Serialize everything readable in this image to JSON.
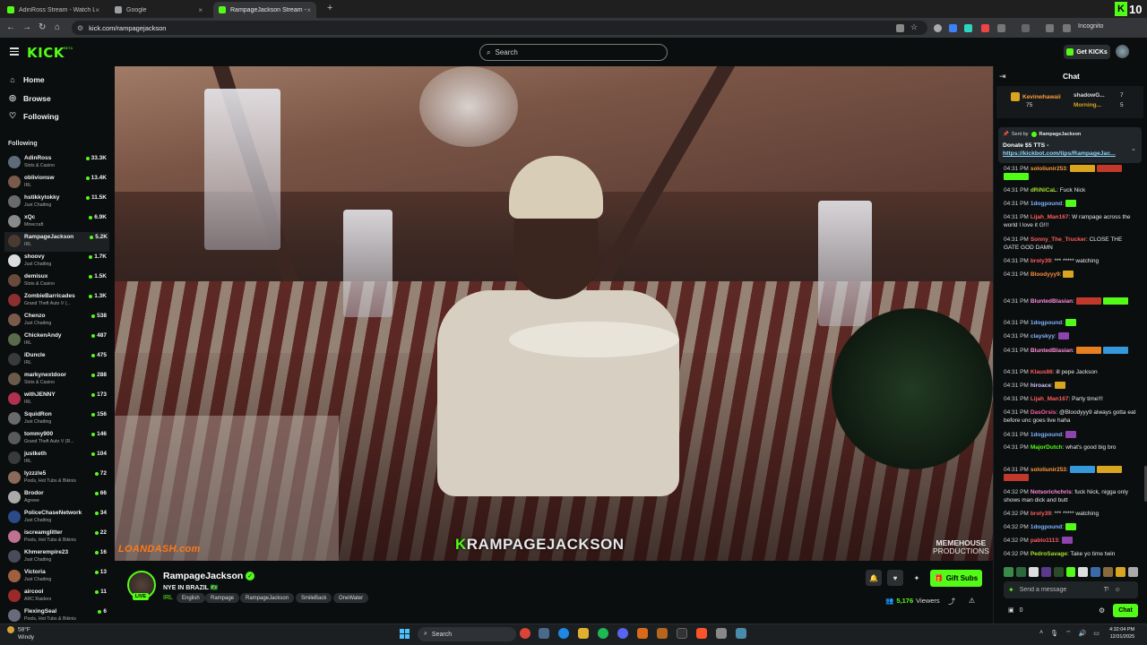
{
  "browser": {
    "tabs": [
      {
        "title": "AdinRoss Stream - Watch Live ...",
        "favicon_color": "#53fc18"
      },
      {
        "title": "Google",
        "favicon_color": "#9aa0a6"
      },
      {
        "title": "RampageJackson Stream - ...",
        "favicon_color": "#53fc18",
        "active": true
      }
    ],
    "new_tab": "+",
    "url": "kick.com/rampagejackson",
    "incognito_label": "Incognito",
    "corner_kick_count": "10",
    "corner_twitch_count": "0"
  },
  "header": {
    "logo": "KICK",
    "logo_beta": "BETA",
    "search_placeholder": "Search",
    "get_kicks": "Get KICKs"
  },
  "sidebar": {
    "nav": [
      {
        "label": "Home",
        "icon": "home-icon"
      },
      {
        "label": "Browse",
        "icon": "browse-icon"
      },
      {
        "label": "Following",
        "icon": "heart-icon"
      }
    ],
    "following_heading": "Following",
    "channels": [
      {
        "name": "AdinRoss",
        "category": "Slots & Casino",
        "viewers": "33.3K",
        "color": "#5d6b7a"
      },
      {
        "name": "oblivionsw",
        "category": "IRL",
        "viewers": "13.4K",
        "color": "#7a5a4a"
      },
      {
        "name": "hstikkytokky",
        "category": "Just Chatting",
        "viewers": "11.5K",
        "color": "#6a6a6a"
      },
      {
        "name": "xQc",
        "category": "Minecraft",
        "viewers": "6.9K",
        "color": "#8a8a8a"
      },
      {
        "name": "RampageJackson",
        "category": "IRL",
        "viewers": "5.2K",
        "color": "#4a3a30",
        "active": true
      },
      {
        "name": "shoovy",
        "category": "Just Chatting",
        "viewers": "1.7K",
        "color": "#ddd"
      },
      {
        "name": "demisux",
        "category": "Slots & Casino",
        "viewers": "1.5K",
        "color": "#6a4a3a"
      },
      {
        "name": "ZombieBarricades",
        "category": "Grand Theft Auto V (...",
        "viewers": "1.3K",
        "color": "#8a3030"
      },
      {
        "name": "Chenzo",
        "category": "Just Chatting",
        "viewers": "538",
        "color": "#7a5a4a"
      },
      {
        "name": "ChickenAndy",
        "category": "IRL",
        "viewers": "487",
        "color": "#5a6a4a"
      },
      {
        "name": "iDuncle",
        "category": "IRL",
        "viewers": "475",
        "color": "#3a3a3a"
      },
      {
        "name": "markynextdoor",
        "category": "Slots & Casino",
        "viewers": "288",
        "color": "#6a5a4a"
      },
      {
        "name": "withJENNY",
        "category": "IRL",
        "viewers": "173",
        "color": "#b03050"
      },
      {
        "name": "SquidRon",
        "category": "Just Chatting",
        "viewers": "156",
        "color": "#6a6a6a"
      },
      {
        "name": "tommy900",
        "category": "Grand Theft Auto V (R...",
        "viewers": "146",
        "color": "#5a5a5a"
      },
      {
        "name": "justketh",
        "category": "IRL",
        "viewers": "104",
        "color": "#3a3a3a"
      },
      {
        "name": "lyzzzle5",
        "category": "Pools, Hot Tubs & Bikinis",
        "viewers": "72",
        "color": "#8a6a5a"
      },
      {
        "name": "Brodor",
        "category": "Agreee",
        "viewers": "66",
        "color": "#aaa"
      },
      {
        "name": "PoliceChaseNetwork",
        "category": "Just Chatting",
        "viewers": "34",
        "color": "#2a4a8a"
      },
      {
        "name": "iscreamglitter",
        "category": "Pools, Hot Tubs & Bikinis",
        "viewers": "22",
        "color": "#c07090"
      },
      {
        "name": "Khmerempire23",
        "category": "Just Chatting",
        "viewers": "16",
        "color": "#4a4a5a"
      },
      {
        "name": "Victoria",
        "category": "Just Chatting",
        "viewers": "13",
        "color": "#a06040"
      },
      {
        "name": "aircool",
        "category": "ARC Raiders",
        "viewers": "11",
        "color": "#9a2a2a"
      },
      {
        "name": "FlexingSeal",
        "category": "Pools, Hot Tubs & Bikinis",
        "viewers": "6",
        "color": "#6a6a7a"
      }
    ]
  },
  "video": {
    "sponsor": "LOANDASH.com",
    "overlay_k": "K",
    "overlay_name": "RAMPAGEJACKSON",
    "watermark_line1": "MEMEHOUSE",
    "watermark_line2": "PRODUCTIONS"
  },
  "stream": {
    "streamer": "RampageJackson",
    "live": "LIVE",
    "title": "NYE IN BRAZIL 🇧🇷",
    "category": "IRL",
    "tags": [
      "English",
      "Rampage",
      "RampageJackson",
      "SmileBack",
      "OneWater"
    ],
    "gift_subs": "Gift Subs",
    "viewers": "5,176",
    "viewers_label": "Viewers"
  },
  "chat": {
    "title": "Chat",
    "pinned": [
      {
        "name": "Kevinwhawaii",
        "count": "75"
      },
      {
        "name": "shadowG...",
        "count": "7"
      },
      {
        "name": "Morning...",
        "count": "5"
      }
    ],
    "tts": {
      "sent_by": "Sent by",
      "sender": "RampageJackson",
      "text": "Donate $5 TTS -",
      "link": "https://kickbot.com/tips/RampageJac..."
    },
    "messages": [
      {
        "time": "04:31 PM",
        "user": "sololiunir253",
        "color": "#ff9a3c",
        "text": "",
        "emotes": 3
      },
      {
        "time": "04:31 PM",
        "user": "dRiNiCaL",
        "color": "#a6e22e",
        "text": "Fuck Nick"
      },
      {
        "time": "04:31 PM",
        "user": "1dogpound",
        "color": "#7fb2ff",
        "text": "",
        "emotes": 1
      },
      {
        "time": "04:31 PM",
        "user": "Lijah_Man167",
        "color": "#ff5c5c",
        "text": "W rampage across the world I love it G!!!"
      },
      {
        "time": "04:31 PM",
        "user": "Sonny_The_Trucker",
        "color": "#ff5c5c",
        "text": "CLOSE THE GATE GOD DAMN"
      },
      {
        "time": "04:31 PM",
        "user": "broly39",
        "color": "#ff5c5c",
        "text": "*** ***** watching"
      },
      {
        "time": "04:31 PM",
        "user": "Bloodyyy9",
        "color": "#ff8a3c",
        "text": "",
        "emotes": 1
      },
      {
        "time": "04:31 PM",
        "user": "BluntedBlasian",
        "color": "#ff8ad8",
        "text": "",
        "emotes": 2
      },
      {
        "time": "04:31 PM",
        "user": "1dogpound",
        "color": "#7fb2ff",
        "text": "",
        "emotes": 1
      },
      {
        "time": "04:31 PM",
        "user": "clayskyy",
        "color": "#8ab4ff",
        "text": "",
        "emotes": 1
      },
      {
        "time": "04:31 PM",
        "user": "BluntedBlasian",
        "color": "#ff8ad8",
        "text": "",
        "emotes": 2
      },
      {
        "time": "04:31 PM",
        "user": "Klaus86",
        "color": "#ff5c5c",
        "text": "ill pepe Jackson"
      },
      {
        "time": "04:31 PM",
        "user": "hiroace",
        "color": "#d4c4ff",
        "text": "",
        "emotes": 1
      },
      {
        "time": "04:31 PM",
        "user": "Lijah_Man167",
        "color": "#ff5c5c",
        "text": "Party time!!!"
      },
      {
        "time": "04:31 PM",
        "user": "DasOrsis",
        "color": "#ff5c9c",
        "text": "@Bloodyyy9 always gotta eat before unc goes live haha"
      },
      {
        "time": "04:31 PM",
        "user": "1dogpound",
        "color": "#7fb2ff",
        "text": "",
        "emotes": 1
      },
      {
        "time": "04:31 PM",
        "user": "MajorDutch",
        "color": "#53fc18",
        "text": "what's good big bro"
      },
      {
        "time": "04:31 PM",
        "user": "sololiunir253",
        "color": "#ff9a3c",
        "text": "",
        "emotes": 3
      },
      {
        "time": "04:32 PM",
        "user": "Notsorichchris",
        "color": "#ff8ad8",
        "text": "fuck Nick, nigga only shows man dick and butt"
      },
      {
        "time": "04:32 PM",
        "user": "broly39",
        "color": "#ff5c5c",
        "text": "*** ***** watching"
      },
      {
        "time": "04:32 PM",
        "user": "1dogpound",
        "color": "#7fb2ff",
        "text": "",
        "emotes": 1
      },
      {
        "time": "04:32 PM",
        "user": "pablo1113",
        "color": "#ff5c5c",
        "text": "",
        "emotes": 1
      },
      {
        "time": "04:32 PM",
        "user": "PedroSavage",
        "color": "#a6e22e",
        "text": "Take yo time twin"
      }
    ],
    "input_placeholder": "Send a message",
    "kicks_count": "0",
    "send_label": "Chat"
  },
  "taskbar": {
    "temp": "58°F",
    "weather": "Windy",
    "search": "Search",
    "time": "4:32:04 PM",
    "date": "12/31/2025"
  }
}
